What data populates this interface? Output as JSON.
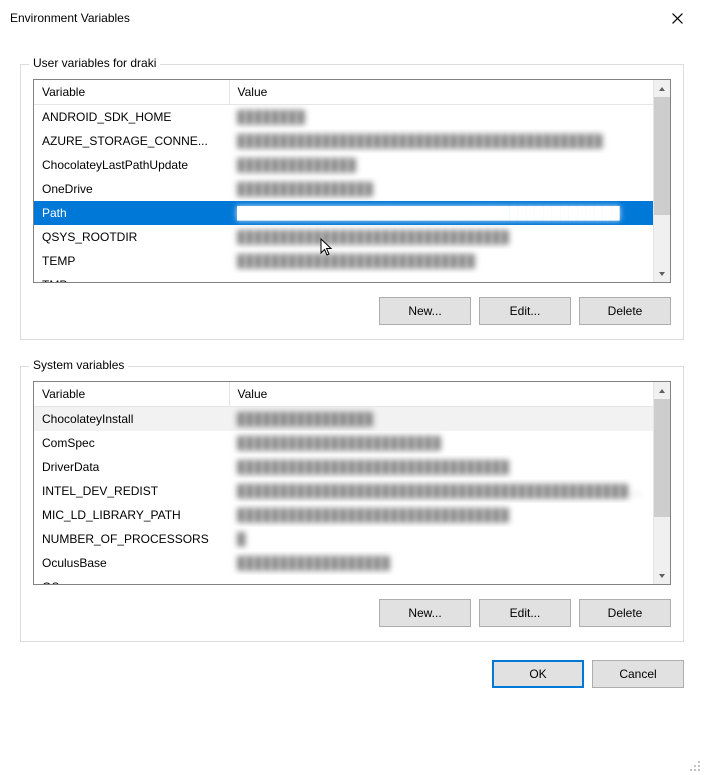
{
  "dialog": {
    "title": "Environment Variables",
    "ok": "OK",
    "cancel": "Cancel"
  },
  "user_section": {
    "label": "User variables for draki",
    "col_variable": "Variable",
    "col_value": "Value",
    "btn_new": "New...",
    "btn_edit": "Edit...",
    "btn_delete": "Delete",
    "rows": [
      {
        "variable": "ANDROID_SDK_HOME",
        "value": "████████",
        "selected": false
      },
      {
        "variable": "AZURE_STORAGE_CONNE...",
        "value": "███████████████████████████████████████████",
        "selected": false
      },
      {
        "variable": "ChocolateyLastPathUpdate",
        "value": "██████████████",
        "selected": false
      },
      {
        "variable": "OneDrive",
        "value": "████████████████",
        "selected": false
      },
      {
        "variable": "Path",
        "value": "█████████████████████████████████████████████",
        "selected": true
      },
      {
        "variable": "QSYS_ROOTDIR",
        "value": "████████████████████████████████",
        "selected": false
      },
      {
        "variable": "TEMP",
        "value": "████████████████████████████",
        "selected": false
      },
      {
        "variable": "TMP",
        "value": "",
        "selected": false
      }
    ]
  },
  "system_section": {
    "label": "System variables",
    "col_variable": "Variable",
    "col_value": "Value",
    "btn_new": "New...",
    "btn_edit": "Edit...",
    "btn_delete": "Delete",
    "rows": [
      {
        "variable": "ChocolateyInstall",
        "value": "████████████████",
        "highlighted": true
      },
      {
        "variable": "ComSpec",
        "value": "████████████████████████",
        "highlighted": false
      },
      {
        "variable": "DriverData",
        "value": "████████████████████████████████",
        "highlighted": false
      },
      {
        "variable": "INTEL_DEV_REDIST",
        "value": "████████████████████████████████████████████████████",
        "highlighted": false
      },
      {
        "variable": "MIC_LD_LIBRARY_PATH",
        "value": "████████████████████████████████",
        "highlighted": false
      },
      {
        "variable": "NUMBER_OF_PROCESSORS",
        "value": "█",
        "highlighted": false
      },
      {
        "variable": "OculusBase",
        "value": "██████████████████",
        "highlighted": false
      },
      {
        "variable": "OS",
        "value": "",
        "highlighted": false
      }
    ]
  }
}
